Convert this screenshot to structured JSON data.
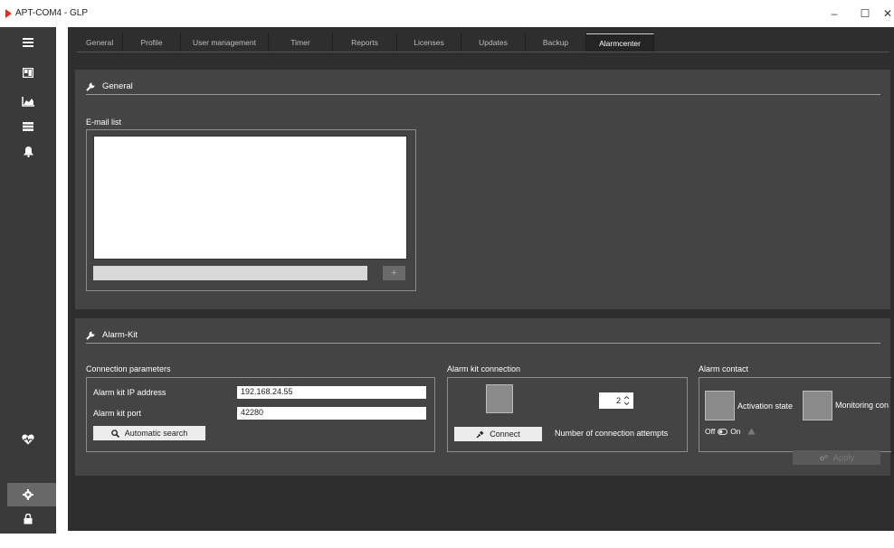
{
  "window": {
    "title": "APT-COM4 - GLP",
    "minimize": "–",
    "maximize": "☐",
    "close": "✕"
  },
  "sidebar": {
    "icons": [
      "menu-icon",
      "dashboard-icon",
      "chart-icon",
      "list-icon",
      "bell-icon",
      "heartbeat-icon",
      "gear-icon",
      "lock-icon",
      "logout-icon"
    ],
    "active": "gear-icon"
  },
  "tabs": [
    {
      "label": "General"
    },
    {
      "label": "Profile"
    },
    {
      "label": "User management"
    },
    {
      "label": "Timer"
    },
    {
      "label": "Reports"
    },
    {
      "label": "Licenses"
    },
    {
      "label": "Updates"
    },
    {
      "label": "Backup"
    },
    {
      "label": "Alarmcenter"
    }
  ],
  "selected_tab": "Alarmcenter",
  "general": {
    "heading": "General",
    "email_list_label": "E-mail list",
    "email_input_value": "",
    "add_label": "+"
  },
  "alarm_kit": {
    "heading": "Alarm-Kit",
    "connection_parameters": {
      "label": "Connection parameters",
      "ip_label": "Alarm kit IP address",
      "ip_value": "192.168.24.55",
      "port_label": "Alarm kit port",
      "port_value": "42280",
      "search_label": "Automatic search"
    },
    "alarm_kit_connection": {
      "label": "Alarm kit connection",
      "attempts_value": "2",
      "connect_label": "Connect",
      "attempts_label": "Number of connection attempts"
    },
    "alarm_contact": {
      "label": "Alarm contact",
      "activation_label": "Activation state",
      "monitoring_label": "Monitoring con",
      "off_label": "Off",
      "on_label": "On"
    },
    "apply_label": "Apply"
  },
  "colors": {
    "accent_red": "#e02b2b",
    "panel": "#444444",
    "background": "#2e2e2e",
    "sidebar": "#3a3a3a"
  }
}
